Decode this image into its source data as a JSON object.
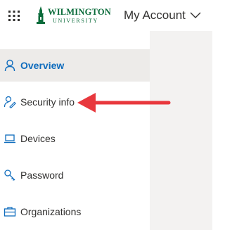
{
  "header": {
    "waffle_icon": "app-launcher-icon",
    "logo": {
      "line1": "WILMINGTON",
      "line2": "UNIVERSITY",
      "color": "#0a6b3a"
    },
    "account_label": "My Account",
    "chevron_icon": "chevron-down-icon"
  },
  "sidebar": {
    "items": [
      {
        "label": "Overview",
        "icon": "person-icon",
        "active": true
      },
      {
        "label": "Security info",
        "icon": "person-key-icon",
        "active": false
      },
      {
        "label": "Devices",
        "icon": "laptop-icon",
        "active": false
      },
      {
        "label": "Password",
        "icon": "key-icon",
        "active": false
      },
      {
        "label": "Organizations",
        "icon": "briefcase-icon",
        "active": false
      }
    ]
  },
  "annotation": {
    "arrow_color": "#e8383d",
    "target": "Security info"
  },
  "colors": {
    "accent": "#0f6cbd",
    "active_bg": "#edebe9",
    "content_bg": "#f3f2f1"
  }
}
